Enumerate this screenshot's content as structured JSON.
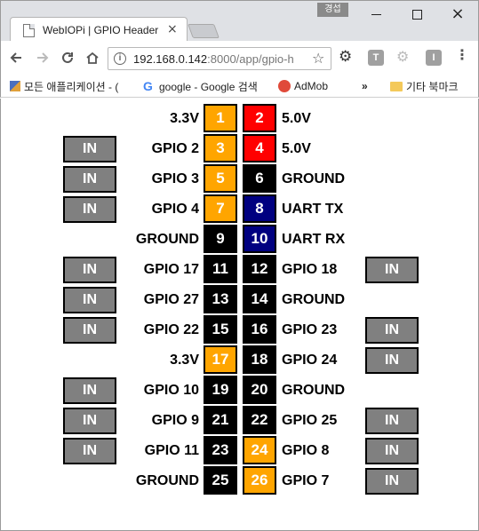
{
  "window": {
    "user_badge": "경섭",
    "tab_title": "WebIOPi | GPIO Header",
    "close_glyph": "×",
    "min_glyph": "—",
    "max_glyph": "☐"
  },
  "toolbar": {
    "url_host": "192.168.0.142",
    "url_rest": ":8000/app/gpio-h",
    "info_glyph": "i",
    "star_glyph": "☆",
    "ext_t": "T",
    "ext_i": "I",
    "menu_glyph": "⋮"
  },
  "bookmarks": {
    "apps": "모든 애플리케이션 - (",
    "google": "google - Google 검색",
    "admob": "AdMob",
    "more": "»",
    "folder": "기타 북마크"
  },
  "colors": {
    "power_3v3": "#ffa500",
    "power_5v": "#ff0000",
    "ground": "#000000",
    "uart": "#000080",
    "in_button": "#808080"
  },
  "pins": [
    {
      "left": {
        "button": "",
        "label": "3.3V",
        "num": "1",
        "color": "#ffa500"
      },
      "right": {
        "num": "2",
        "color": "#ff0000",
        "label": "5.0V",
        "button": ""
      }
    },
    {
      "left": {
        "button": "IN",
        "label": "GPIO 2",
        "num": "3",
        "color": "#ffa500"
      },
      "right": {
        "num": "4",
        "color": "#ff0000",
        "label": "5.0V",
        "button": ""
      }
    },
    {
      "left": {
        "button": "IN",
        "label": "GPIO 3",
        "num": "5",
        "color": "#ffa500"
      },
      "right": {
        "num": "6",
        "color": "#000000",
        "label": "GROUND",
        "button": ""
      }
    },
    {
      "left": {
        "button": "IN",
        "label": "GPIO 4",
        "num": "7",
        "color": "#ffa500"
      },
      "right": {
        "num": "8",
        "color": "#000080",
        "label": "UART TX",
        "button": ""
      }
    },
    {
      "left": {
        "button": "",
        "label": "GROUND",
        "num": "9",
        "color": "#000000"
      },
      "right": {
        "num": "10",
        "color": "#000080",
        "label": "UART RX",
        "button": ""
      }
    },
    {
      "left": {
        "button": "IN",
        "label": "GPIO 17",
        "num": "11",
        "color": "#000000"
      },
      "right": {
        "num": "12",
        "color": "#000000",
        "label": "GPIO 18",
        "button": "IN"
      }
    },
    {
      "left": {
        "button": "IN",
        "label": "GPIO 27",
        "num": "13",
        "color": "#000000"
      },
      "right": {
        "num": "14",
        "color": "#000000",
        "label": "GROUND",
        "button": ""
      }
    },
    {
      "left": {
        "button": "IN",
        "label": "GPIO 22",
        "num": "15",
        "color": "#000000"
      },
      "right": {
        "num": "16",
        "color": "#000000",
        "label": "GPIO 23",
        "button": "IN"
      }
    },
    {
      "left": {
        "button": "",
        "label": "3.3V",
        "num": "17",
        "color": "#ffa500"
      },
      "right": {
        "num": "18",
        "color": "#000000",
        "label": "GPIO 24",
        "button": "IN"
      }
    },
    {
      "left": {
        "button": "IN",
        "label": "GPIO 10",
        "num": "19",
        "color": "#000000"
      },
      "right": {
        "num": "20",
        "color": "#000000",
        "label": "GROUND",
        "button": ""
      }
    },
    {
      "left": {
        "button": "IN",
        "label": "GPIO 9",
        "num": "21",
        "color": "#000000"
      },
      "right": {
        "num": "22",
        "color": "#000000",
        "label": "GPIO 25",
        "button": "IN"
      }
    },
    {
      "left": {
        "button": "IN",
        "label": "GPIO 11",
        "num": "23",
        "color": "#000000"
      },
      "right": {
        "num": "24",
        "color": "#ffa500",
        "label": "GPIO 8",
        "button": "IN"
      }
    },
    {
      "left": {
        "button": "",
        "label": "GROUND",
        "num": "25",
        "color": "#000000"
      },
      "right": {
        "num": "26",
        "color": "#ffa500",
        "label": "GPIO 7",
        "button": "IN"
      }
    }
  ]
}
